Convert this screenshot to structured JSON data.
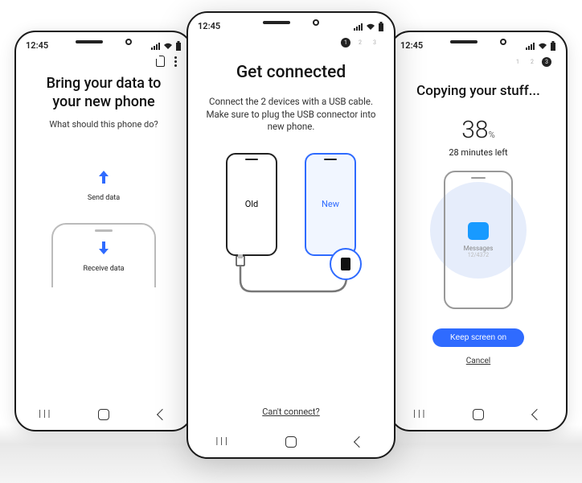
{
  "status": {
    "time": "12:45"
  },
  "left": {
    "title_line1": "Bring your data to",
    "title_line2": "your new phone",
    "subtitle": "What should this phone do?",
    "send_label": "Send data",
    "receive_label": "Receive data"
  },
  "center": {
    "step_active": "1",
    "step_2": "2",
    "step_3": "3",
    "title": "Get connected",
    "subtitle": "Connect the 2 devices with a USB cable. Make sure to plug the USB connector into new phone.",
    "old_label": "Old",
    "new_label": "New",
    "cant_connect": "Can't connect?"
  },
  "right": {
    "step_1": "1",
    "step_2": "2",
    "step_active": "3",
    "title": "Copying your stuff...",
    "percent": "38",
    "percent_unit": "%",
    "eta": "28 minutes left",
    "item_label": "Messages",
    "item_count": "12/4372",
    "keep_screen": "Keep screen on",
    "cancel": "Cancel"
  }
}
